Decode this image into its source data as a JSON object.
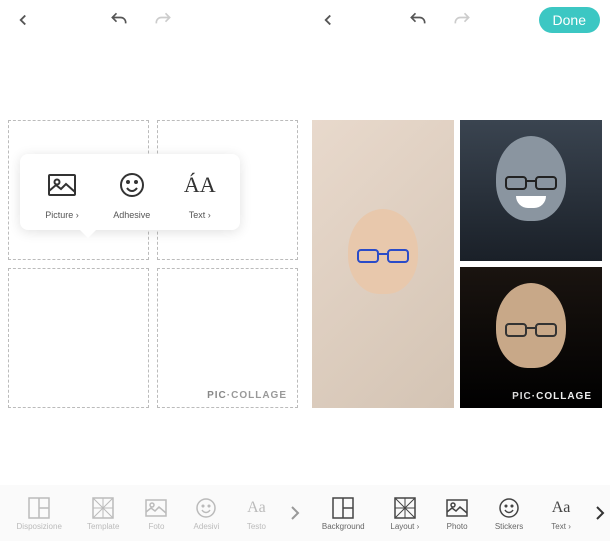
{
  "left": {
    "popup": {
      "picture": "Picture ›",
      "adhesive": "Adhesive",
      "text": "Text ›"
    },
    "watermark_pic": "PIC",
    "watermark_collage": "·COLLAGE",
    "toolbar": {
      "disposizione": "Disposizione",
      "template": "Template",
      "foto": "Foto",
      "adesivi": "Adesivi",
      "testo": "Testo"
    }
  },
  "right": {
    "done": "Done",
    "watermark_pic": "PIC",
    "watermark_collage": "·COLLAGE",
    "toolbar": {
      "background": "Background",
      "layout": "Layout ›",
      "photo": "Photo",
      "stickers": "Stickers",
      "text": "Text ›"
    }
  }
}
